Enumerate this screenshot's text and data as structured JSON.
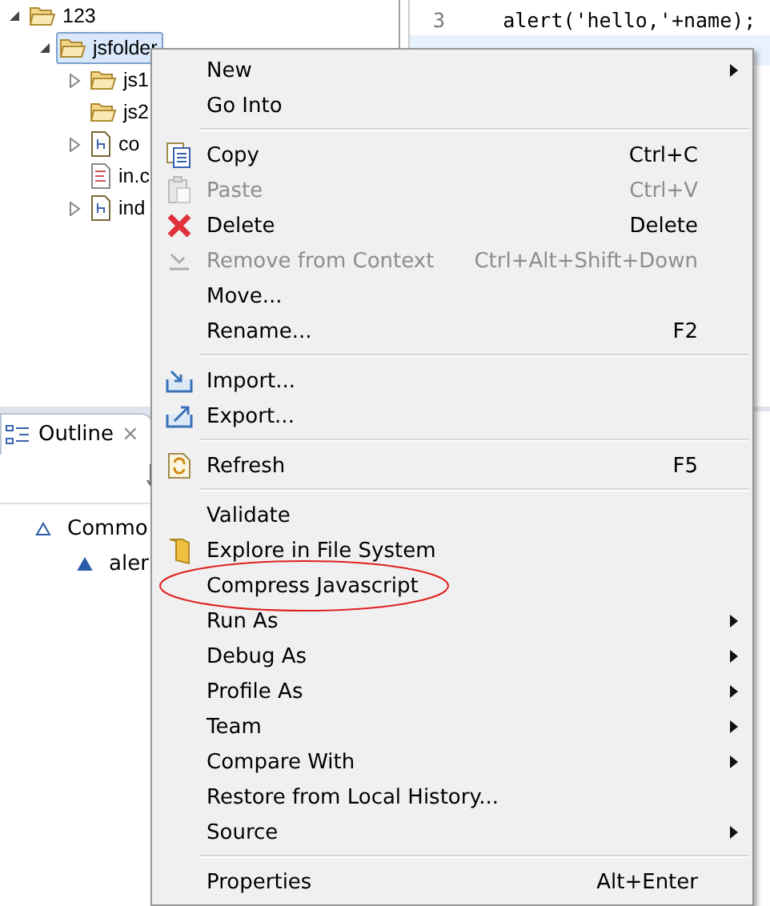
{
  "explorer": {
    "tree": [
      {
        "label": "123",
        "kind": "folder",
        "expanded": true,
        "selected": false,
        "children": [
          {
            "label": "jsfolder",
            "kind": "folder",
            "expanded": true,
            "selected": true,
            "children": [
              {
                "label": "js1",
                "kind": "folder",
                "expanded": false,
                "selected": false
              },
              {
                "label": "js2",
                "kind": "folder",
                "selected": false
              },
              {
                "label": "co",
                "kind": "script",
                "expanded": false,
                "selected": false
              },
              {
                "label": "in.c",
                "kind": "text",
                "selected": false
              },
              {
                "label": "ind",
                "kind": "script",
                "expanded": false,
                "selected": false
              }
            ]
          }
        ]
      }
    ]
  },
  "editor": {
    "lines": [
      {
        "number": "3",
        "code": "    alert('hello,'+name);"
      }
    ]
  },
  "outline": {
    "tab": {
      "label": "Outline",
      "close": "×"
    },
    "tree": [
      {
        "label": "Commo",
        "children": [
          {
            "label": "aler"
          }
        ]
      }
    ]
  },
  "context_menu": {
    "items": [
      {
        "kind": "item",
        "label": "New",
        "submenu": true,
        "disabled": false,
        "circled": false
      },
      {
        "kind": "item",
        "label": "Go Into",
        "submenu": false,
        "disabled": false,
        "circled": false
      },
      {
        "kind": "separator"
      },
      {
        "kind": "item",
        "label": "Copy",
        "shortcut": "Ctrl+C",
        "submenu": false,
        "disabled": false,
        "circled": false
      },
      {
        "kind": "item",
        "label": "Paste",
        "shortcut": "Ctrl+V",
        "submenu": false,
        "disabled": true,
        "circled": false
      },
      {
        "kind": "item",
        "label": "Delete",
        "shortcut": "Delete",
        "submenu": false,
        "disabled": false,
        "circled": false
      },
      {
        "kind": "item",
        "label": "Remove from Context",
        "shortcut": "Ctrl+Alt+Shift+Down",
        "submenu": false,
        "disabled": true,
        "circled": false
      },
      {
        "kind": "item",
        "label": "Move...",
        "submenu": false,
        "disabled": false,
        "circled": false
      },
      {
        "kind": "item",
        "label": "Rename...",
        "shortcut": "F2",
        "submenu": false,
        "disabled": false,
        "circled": false
      },
      {
        "kind": "separator"
      },
      {
        "kind": "item",
        "label": "Import...",
        "submenu": false,
        "disabled": false,
        "circled": false
      },
      {
        "kind": "item",
        "label": "Export...",
        "submenu": false,
        "disabled": false,
        "circled": false
      },
      {
        "kind": "separator"
      },
      {
        "kind": "item",
        "label": "Refresh",
        "shortcut": "F5",
        "submenu": false,
        "disabled": false,
        "circled": false
      },
      {
        "kind": "separator"
      },
      {
        "kind": "item",
        "label": "Validate",
        "submenu": false,
        "disabled": false,
        "circled": false
      },
      {
        "kind": "item",
        "label": "Explore in File System",
        "submenu": false,
        "disabled": false,
        "circled": false
      },
      {
        "kind": "item",
        "label": "Compress Javascript",
        "submenu": false,
        "disabled": false,
        "circled": true
      },
      {
        "kind": "item",
        "label": "Run As",
        "submenu": true,
        "disabled": false,
        "circled": false
      },
      {
        "kind": "item",
        "label": "Debug As",
        "submenu": true,
        "disabled": false,
        "circled": false
      },
      {
        "kind": "item",
        "label": "Profile As",
        "submenu": true,
        "disabled": false,
        "circled": false
      },
      {
        "kind": "item",
        "label": "Team",
        "submenu": true,
        "disabled": false,
        "circled": false
      },
      {
        "kind": "item",
        "label": "Compare With",
        "submenu": true,
        "disabled": false,
        "circled": false
      },
      {
        "kind": "item",
        "label": "Restore from Local History...",
        "submenu": false,
        "disabled": false,
        "circled": false
      },
      {
        "kind": "item",
        "label": "Source",
        "submenu": true,
        "disabled": false,
        "circled": false
      },
      {
        "kind": "separator"
      },
      {
        "kind": "item",
        "label": "Properties",
        "shortcut": "Alt+Enter",
        "submenu": false,
        "disabled": false,
        "circled": false
      }
    ]
  }
}
